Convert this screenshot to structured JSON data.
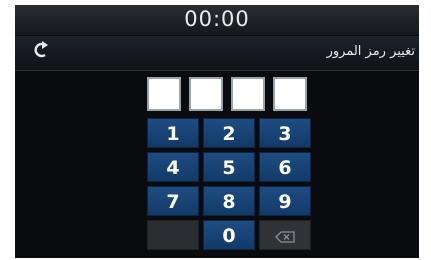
{
  "status": {
    "clock": "00:00"
  },
  "header": {
    "title": "تغيير رمز المرور",
    "back_icon": "back-arrow-icon"
  },
  "pin": {
    "slots": 4
  },
  "keypad": {
    "keys": [
      "1",
      "2",
      "3",
      "4",
      "5",
      "6",
      "7",
      "8",
      "9",
      "",
      "0",
      "⌫"
    ]
  },
  "colors": {
    "key": "#1a4a80",
    "accent": "#ffffff"
  }
}
